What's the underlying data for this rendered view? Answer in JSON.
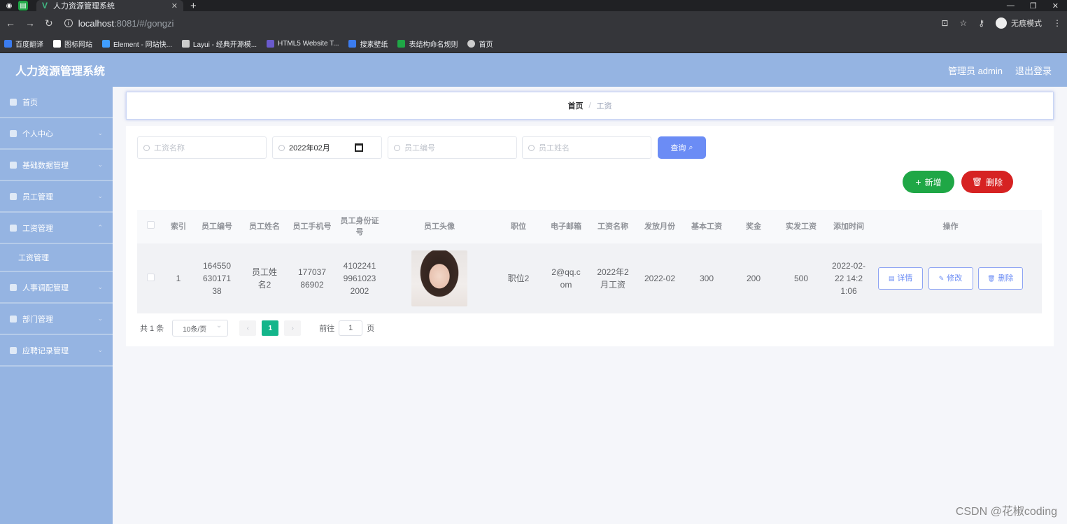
{
  "browser": {
    "tab_title": "人力资源管理系统",
    "url_host": "localhost",
    "url_rest": ":8081/#/gongzi",
    "incognito_label": "无痕模式",
    "bookmarks": [
      {
        "label": "百度翻译",
        "color": "#3b7cf0"
      },
      {
        "label": "图标网站",
        "color": "#ffffff"
      },
      {
        "label": "Element - 网站快...",
        "color": "#409eff"
      },
      {
        "label": "Layui - 经典开源模...",
        "color": "#cccccc"
      },
      {
        "label": "HTML5 Website T...",
        "color": "#6a5acd"
      },
      {
        "label": "搜素壁纸",
        "color": "#3b7cf0"
      },
      {
        "label": "表结构命名规则",
        "color": "#1fa746"
      },
      {
        "label": "首页",
        "color": "#cccccc"
      }
    ]
  },
  "header": {
    "title": "人力资源管理系统",
    "user": "管理员 admin",
    "logout": "退出登录"
  },
  "sidebar": {
    "items": [
      {
        "label": "首页"
      },
      {
        "label": "个人中心"
      },
      {
        "label": "基础数据管理"
      },
      {
        "label": "员工管理"
      },
      {
        "label": "工资管理"
      },
      {
        "label": "工资管理"
      },
      {
        "label": "人事调配管理"
      },
      {
        "label": "部门管理"
      },
      {
        "label": "应聘记录管理"
      }
    ]
  },
  "breadcrumb": {
    "home": "首页",
    "sep": "/",
    "current": "工资"
  },
  "search": {
    "salary_name_placeholder": "工资名称",
    "month_value": "2022年02月",
    "emp_no_placeholder": "员工编号",
    "emp_name_placeholder": "员工姓名",
    "query_label": "查询"
  },
  "actions": {
    "add_label": "新增",
    "delete_label": "删除"
  },
  "table": {
    "headers": [
      "索引",
      "员工编号",
      "员工姓名",
      "员工手机号",
      "员工身份证号",
      "员工头像",
      "职位",
      "电子邮箱",
      "工资名称",
      "发放月份",
      "基本工资",
      "奖金",
      "实发工资",
      "添加时间",
      "操作"
    ],
    "row": {
      "index": "1",
      "emp_no": "16455063017138",
      "emp_name": "员工姓名2",
      "phone": "17703786902",
      "id_card": "410224199610232002",
      "position": "职位2",
      "email": "2@qq.com",
      "salary_name": "2022年2月工资",
      "month": "2022-02",
      "base": "300",
      "bonus": "200",
      "actual": "500",
      "added": "2022-02-22 14:21:06",
      "btn_detail": "详情",
      "btn_edit": "修改",
      "btn_delete": "删除"
    }
  },
  "pager": {
    "total": "共 1 条",
    "page_size": "10条/页",
    "current": "1",
    "goto_prefix": "前往",
    "goto_value": "1",
    "goto_suffix": "页"
  },
  "watermark": "CSDN @花椒coding"
}
